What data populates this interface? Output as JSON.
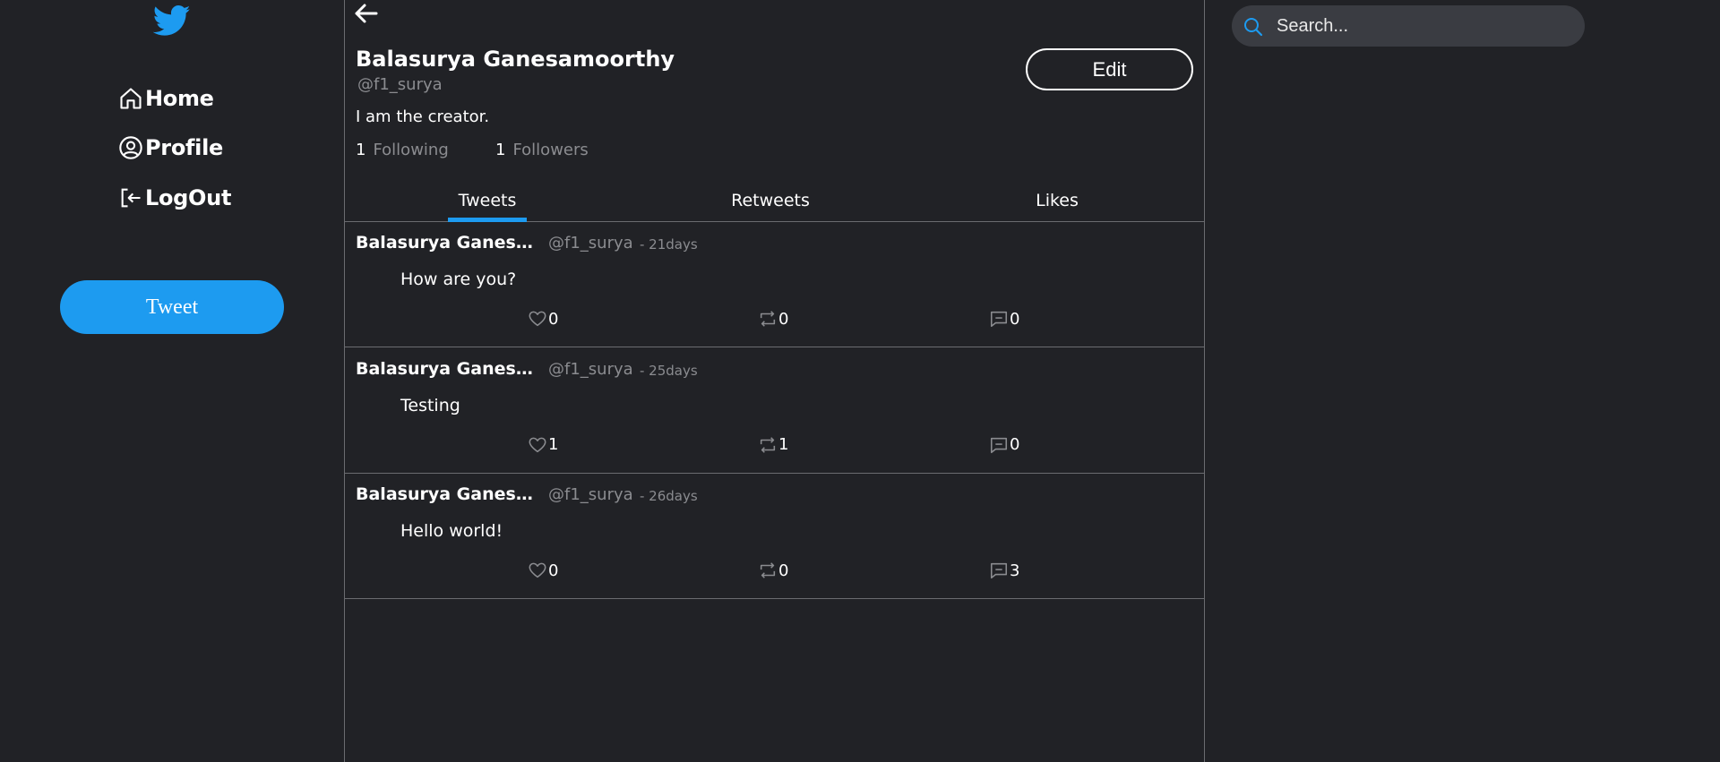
{
  "colors": {
    "background": "#212226",
    "accent": "#1d9bf0",
    "muted_text": "#8b8c90",
    "divider": "#6b6c70",
    "search_bg": "#3a3c42"
  },
  "sidebar": {
    "logo_icon": "twitter-bird-icon",
    "items": [
      {
        "label": "Home",
        "icon": "home-icon"
      },
      {
        "label": "Profile",
        "icon": "user-circle-icon"
      },
      {
        "label": "LogOut",
        "icon": "logout-icon"
      }
    ],
    "tweet_button": "Tweet"
  },
  "profile": {
    "back_icon": "arrow-left-icon",
    "name": "Balasurya Ganesamoorthy",
    "handle": "@f1_surya",
    "edit_label": "Edit",
    "bio": "I am the creator.",
    "following_count": "1",
    "following_label": "Following",
    "followers_count": "1",
    "followers_label": "Followers"
  },
  "tabs": [
    {
      "label": "Tweets",
      "active": true
    },
    {
      "label": "Retweets",
      "active": false
    },
    {
      "label": "Likes",
      "active": false
    }
  ],
  "tweets": [
    {
      "author": "Balasurya Ganesamoorthy",
      "handle": "@f1_surya",
      "time": "- 21days",
      "text": "How are you?",
      "likes": "0",
      "retweets": "0",
      "comments": "0"
    },
    {
      "author": "Balasurya Ganesamoorthy",
      "handle": "@f1_surya",
      "time": "- 25days",
      "text": "Testing",
      "likes": "1",
      "retweets": "1",
      "comments": "0"
    },
    {
      "author": "Balasurya Ganesamoorthy",
      "handle": "@f1_surya",
      "time": "- 26days",
      "text": "Hello world!",
      "likes": "0",
      "retweets": "0",
      "comments": "3"
    }
  ],
  "search": {
    "placeholder": "Search...",
    "icon": "search-icon"
  }
}
